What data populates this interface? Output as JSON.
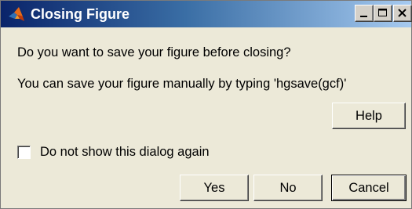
{
  "window": {
    "title": "Closing Figure",
    "app_icon": "matlab-icon",
    "controls": {
      "minimize_icon": "minimize-icon",
      "maximize_icon": "maximize-icon",
      "close_icon": "close-icon"
    }
  },
  "message": {
    "line1": "Do you want to save your figure before closing?",
    "line2": "You can save your figure manually by typing 'hgsave(gcf)'"
  },
  "help_button": {
    "label": "Help"
  },
  "checkbox": {
    "label": "Do not show this dialog again",
    "checked": false
  },
  "buttons": {
    "yes": "Yes",
    "no": "No",
    "cancel": "Cancel"
  },
  "colors": {
    "titlebar_start": "#0a246a",
    "titlebar_end": "#a6caf0",
    "dialog_bg": "#ece9d8"
  }
}
